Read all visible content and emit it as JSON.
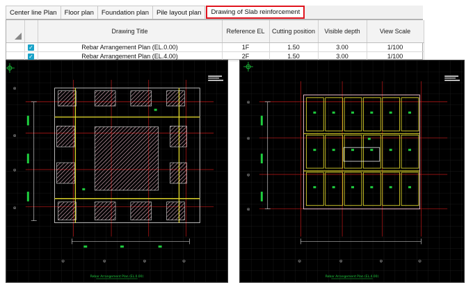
{
  "tabs": [
    {
      "label": "Center line Plan",
      "active": false
    },
    {
      "label": "Floor plan",
      "active": false
    },
    {
      "label": "Foundation plan",
      "active": false
    },
    {
      "label": "Pile layout plan",
      "active": false
    },
    {
      "label": "Drawing of Slab reinforcement",
      "active": true
    }
  ],
  "table": {
    "headers": [
      "Drawing Title",
      "Reference EL",
      "Cutting position",
      "Visible depth",
      "View Scale"
    ],
    "rows": [
      {
        "checked": true,
        "title": "Rebar Arrangement Plan (EL.0.00)",
        "ref": "1F",
        "cut": "1.50",
        "depth": "3.00",
        "scale": "1/100"
      },
      {
        "checked": true,
        "title": "Rebar Arrangement Plan (EL.4.00)",
        "ref": "2F",
        "cut": "1.50",
        "depth": "3.00",
        "scale": "1/100"
      }
    ]
  },
  "drawings": [
    {
      "caption": "Rebar Arrangement Plan (EL.0.00)"
    },
    {
      "caption": "Rebar Arrangement Plan (EL.4.00)"
    }
  ],
  "colors": {
    "cad_background": "#000000",
    "grid_line": "#2e2e2e",
    "axis_line": "#c01818",
    "hatch_pink": "#e8b8c8",
    "beam_yellow": "#d8cf2a",
    "dimension_white": "#e6e6e6",
    "marker_green": "#1fcf3f",
    "tab_highlight": "#e0141e",
    "checkbox": "#1aa3c8"
  },
  "icons": {
    "sort_corner": "triangle-corner-icon",
    "checkbox": "checkmark-icon",
    "ucs": "ucs-axis-icon"
  }
}
